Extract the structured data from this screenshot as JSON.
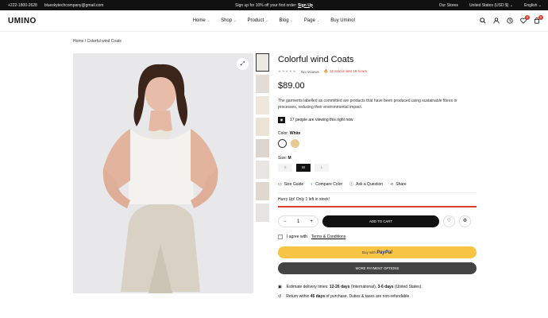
{
  "topbar": {
    "phone": "+222-1800-2628",
    "email": "blueskytechcompany@gmail.com",
    "promo": "Sign up for 10% off your first order:",
    "promo_link": "Sign Up",
    "stores": "Our Stores",
    "currency": "United States (USD $)",
    "language": "English"
  },
  "header": {
    "logo": "UMINO",
    "nav": [
      {
        "label": "Home"
      },
      {
        "label": "Shop"
      },
      {
        "label": "Product"
      },
      {
        "label": "Blog"
      },
      {
        "label": "Page"
      },
      {
        "label": "Buy Umino!"
      }
    ],
    "wishlist_count": "0",
    "cart_count": "0"
  },
  "breadcrumb": {
    "home": "Home",
    "current": "Colorful wind Coats"
  },
  "product": {
    "title": "Colorful wind Coats",
    "reviews": "No reviews",
    "sold": "12 sold in last 18 hours",
    "price": "$89.00",
    "description": "The garments labelled as committed are products that have been produced using sustainable fibres or processes, reducing their environmental impact.",
    "viewing": "17 people are viewing this right now",
    "color_label": "Color:",
    "color_value": "White",
    "size_label": "Size:",
    "size_value": "M",
    "sizes": [
      "S",
      "M",
      "L"
    ],
    "links": [
      "Size Guide",
      "Compare Color",
      "Ask a Question",
      "Share"
    ],
    "hurry": "Hurry Up! Only 1 left in stock!",
    "stock_fill": 1.0,
    "qty": "1",
    "add_to_cart": "ADD TO CART",
    "agree_text": "I agree with",
    "terms": "Terms & Conditions",
    "paypal_prefix": "Buy with",
    "paypal_brand": "PayPal",
    "more_payment": "MORE PAYMENT OPTIONS",
    "delivery_prefix": "Estimate delivery times:",
    "delivery_intl": "12-26 days",
    "delivery_intl_suffix": "(International),",
    "delivery_us": "3-6 days",
    "delivery_us_suffix": "(United States).",
    "return_prefix": "Return within",
    "return_days": "45 days",
    "return_suffix": "of purchase. Duties & taxes are non-refundable."
  },
  "colors": {
    "accent": "#d9412e",
    "dark": "#111111",
    "paypal": "#f7c443"
  }
}
